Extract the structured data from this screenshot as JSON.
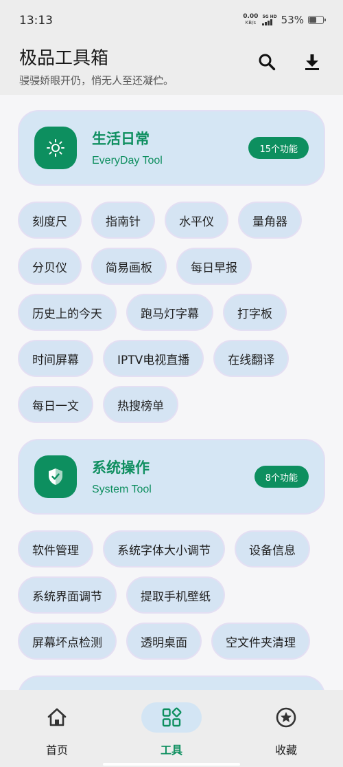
{
  "status": {
    "time": "13:13",
    "net_speed_value": "0.00",
    "net_speed_unit": "KB/s",
    "network_label": "5G HD",
    "battery": "53%",
    "battery_level": 0.53
  },
  "header": {
    "title": "极品工具箱",
    "subtitle": "骎骎娇眼开仍，悄无人至还凝伫。",
    "search_icon": "search-icon",
    "download_icon": "download-icon"
  },
  "categories": [
    {
      "title": "生活日常",
      "subtitle": "EveryDay Tool",
      "badge": "15个功能",
      "icon": "sun-icon",
      "tools": [
        [
          "刻度尺",
          "指南针",
          "水平仪",
          "量角器"
        ],
        [
          "分贝仪",
          "简易画板",
          "每日早报"
        ],
        [
          "历史上的今天",
          "跑马灯字幕",
          "打字板"
        ],
        [
          "时间屏幕",
          "IPTV电视直播",
          "在线翻译"
        ],
        [
          "每日一文",
          "热搜榜单"
        ]
      ]
    },
    {
      "title": "系统操作",
      "subtitle": "System Tool",
      "badge": "8个功能",
      "icon": "shield-icon",
      "tools": [
        [
          "软件管理",
          "系统字体大小调节",
          "设备信息"
        ],
        [
          "系统界面调节",
          "提取手机壁纸"
        ],
        [
          "屏幕坏点检测",
          "透明桌面",
          "空文件夹清理"
        ]
      ]
    }
  ],
  "bottom_nav": [
    {
      "label": "首页",
      "icon": "home-icon",
      "active": false
    },
    {
      "label": "工具",
      "icon": "tools-icon",
      "active": true
    },
    {
      "label": "收藏",
      "icon": "star-icon",
      "active": false
    }
  ],
  "colors": {
    "accent": "#0d8f5f",
    "card_bg": "#d5e6f4",
    "page_bg": "#f6f6f8",
    "bar_bg": "#ededed"
  }
}
